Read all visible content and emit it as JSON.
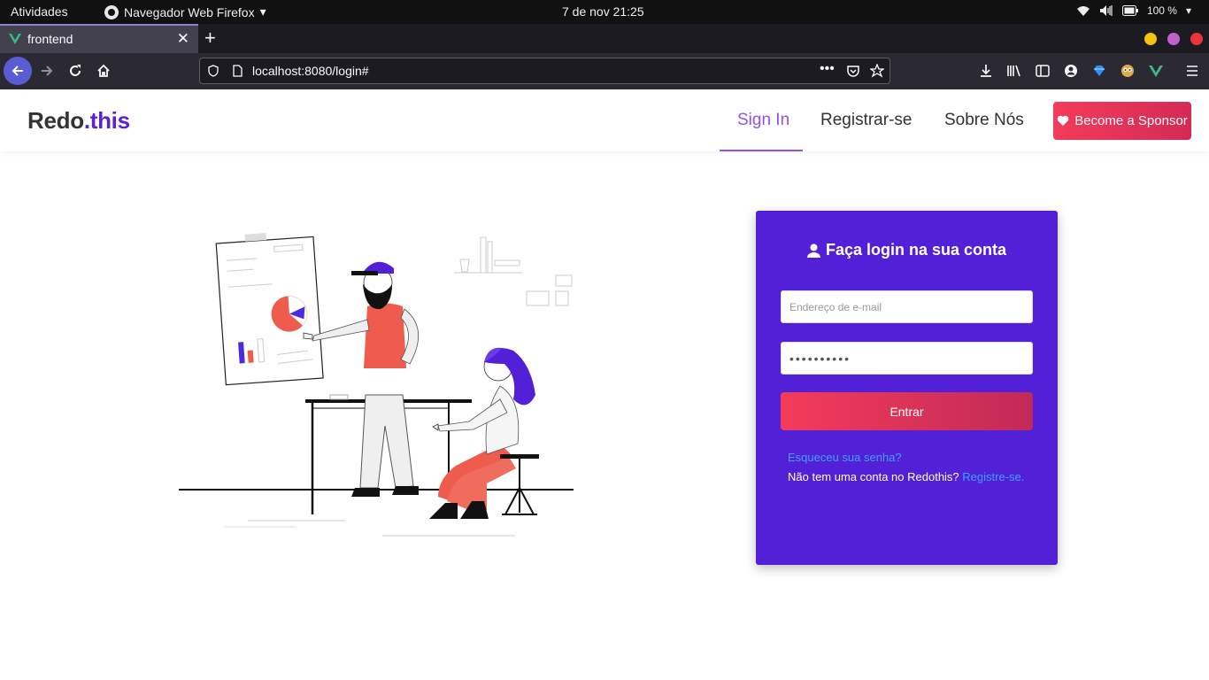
{
  "os_bar": {
    "activities": "Atividades",
    "app_name": "Navegador Web Firefox",
    "clock": "7 de nov  21:25",
    "battery": "100 %"
  },
  "browser": {
    "tab_title": "frontend",
    "url": "localhost:8080/login#",
    "window_controls": {
      "minimize_color": "#f5c211",
      "maximize_color": "#c061cb",
      "close_color": "#ed333b"
    }
  },
  "site": {
    "brand_part1": "Redo",
    "brand_part2": ".this",
    "nav": {
      "sign_in": "Sign In",
      "register": "Registrar-se",
      "about": "Sobre Nós"
    },
    "sponsor_label": "Become a Sponsor",
    "accent_color": "#5220d6",
    "sponsor_color": "#f43b5a"
  },
  "login": {
    "title": "Faça login na sua conta",
    "email_placeholder": "Endereço de e-mail",
    "password_value": "••••••••••",
    "submit_label": "Entrar",
    "forgot_label": "Esqueceu sua senha?",
    "no_account_text": "Não tem uma conta no Redothis?",
    "register_link": "Registre-se."
  }
}
